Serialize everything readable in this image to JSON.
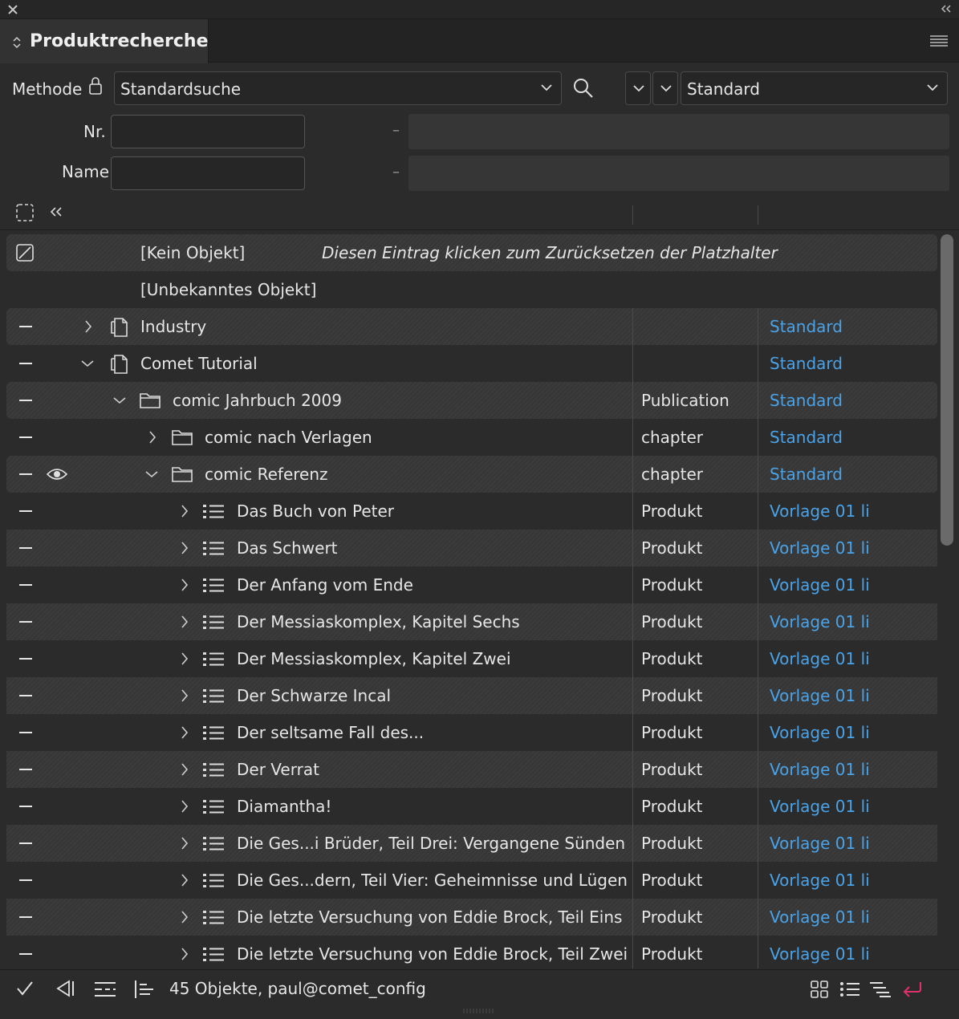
{
  "window": {
    "close_icon": "close-icon",
    "collapse_icon": "double-chevron-left-icon"
  },
  "panel": {
    "title": "Produktrecherche",
    "menu_icon": "hamburger-menu-icon"
  },
  "search": {
    "method_label": "Methode",
    "method_value": "Standardsuche",
    "view_value": "Standard",
    "nr_label": "Nr.",
    "nr_value": "",
    "name_label": "Name",
    "name_value": "",
    "range_dash": "–"
  },
  "list": {
    "no_object": "[Kein Objekt]",
    "no_object_hint": "Diesen Eintrag klicken zum Zurücksetzen der Platzhalter",
    "unknown_object": "[Unbekanntes Objekt]",
    "rows": [
      {
        "name": "Industry",
        "type": "",
        "template": "Standard"
      },
      {
        "name": "Comet Tutorial",
        "type": "",
        "template": "Standard"
      },
      {
        "name": "comic Jahrbuch 2009",
        "type": "Publication",
        "template": "Standard"
      },
      {
        "name": "comic nach Verlagen",
        "type": "chapter",
        "template": "Standard"
      },
      {
        "name": "comic Referenz",
        "type": "chapter",
        "template": "Standard"
      },
      {
        "name": "Das Buch von Peter",
        "type": "Produkt",
        "template": "Vorlage 01 li"
      },
      {
        "name": "Das Schwert",
        "type": "Produkt",
        "template": "Vorlage 01 li"
      },
      {
        "name": "Der Anfang vom Ende",
        "type": "Produkt",
        "template": "Vorlage 01 li"
      },
      {
        "name": "Der Messiaskomplex,  Kapitel Sechs",
        "type": "Produkt",
        "template": "Vorlage 01 li"
      },
      {
        "name": "Der Messiaskomplex,  Kapitel Zwei",
        "type": "Produkt",
        "template": "Vorlage 01 li"
      },
      {
        "name": "Der Schwarze Incal",
        "type": "Produkt",
        "template": "Vorlage 01 li"
      },
      {
        "name": "Der seltsame Fall des...",
        "type": "Produkt",
        "template": "Vorlage 01 li"
      },
      {
        "name": "Der Verrat",
        "type": "Produkt",
        "template": "Vorlage 01 li"
      },
      {
        "name": "Diamantha!",
        "type": "Produkt",
        "template": "Vorlage 01 li"
      },
      {
        "name": "Die Ges...i Brüder,  Teil Drei: Vergangene Sünden",
        "type": "Produkt",
        "template": "Vorlage 01 li"
      },
      {
        "name": "Die Ges...dern,  Teil Vier: Geheimnisse und Lügen",
        "type": "Produkt",
        "template": "Vorlage 01 li"
      },
      {
        "name": "Die letzte Versuchung von Eddie Brock,  Teil Eins",
        "type": "Produkt",
        "template": "Vorlage 01 li"
      },
      {
        "name": "Die letzte Versuchung von Eddie Brock,  Teil Zwei",
        "type": "Produkt",
        "template": "Vorlage 01 li"
      }
    ]
  },
  "footer": {
    "status": "45 Objekte, paul@comet_config"
  },
  "colors": {
    "link": "#4aa3e8",
    "accent_return": "#e0306a"
  }
}
